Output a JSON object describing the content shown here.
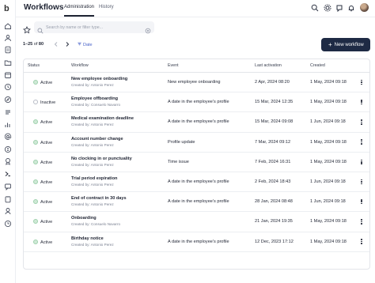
{
  "header": {
    "title": "Workflows",
    "tabs": [
      {
        "label": "Administration",
        "active": true
      },
      {
        "label": "History",
        "active": false
      }
    ],
    "icons": [
      "search-icon",
      "gear-icon",
      "help-icon",
      "bell-icon",
      "avatar"
    ]
  },
  "sidebar": {
    "logo": "b",
    "items": [
      "home-icon",
      "people-icon",
      "document-icon",
      "folder-icon",
      "calendar-icon",
      "clock-icon",
      "compass-icon",
      "checklist-icon",
      "chart-icon",
      "at-icon",
      "payroll-icon",
      "award-icon",
      "workflow-icon",
      "message-icon",
      "clipboard-icon",
      "user-icon",
      "history-icon"
    ]
  },
  "toolbar": {
    "search_placeholder": "Search by name or filter type...",
    "pager_range": "1–25",
    "pager_of": "of",
    "pager_total": "80",
    "sort_label": "Date",
    "new_button": "New workflow"
  },
  "table": {
    "columns": [
      "Status",
      "Workflow",
      "Event",
      "Last activation",
      "Created"
    ],
    "rows": [
      {
        "status": "Active",
        "name": "New employee onboarding",
        "by": "Created by: Antonio Perez",
        "event": "New employee onboarding",
        "last": "2 Apr, 2024 08:20",
        "created": "1 May, 2024 09:18"
      },
      {
        "status": "Inactive",
        "name": "Employee offboarding",
        "by": "Created by: Consuelo Navarro",
        "event": "A date in the employee's profile",
        "last": "15 Mar, 2024 12:35",
        "created": "1 May, 2024 09:18"
      },
      {
        "status": "Active",
        "name": "Medical examination deadline",
        "by": "Created by: Antonio Perez",
        "event": "A date in the employee's profile",
        "last": "15 Mar, 2024 09:08",
        "created": "1 Jun, 2024 09:18"
      },
      {
        "status": "Active",
        "name": "Account number change",
        "by": "Created by: Antonio Perez",
        "event": "Profile update",
        "last": "7 Mar, 2024 09:12",
        "created": "1 May, 2024 09:18"
      },
      {
        "status": "Active",
        "name": "No clocking in or punctuality",
        "by": "Created by: Antonio Perez",
        "event": "Time issue",
        "last": "7 Feb, 2024 16:31",
        "created": "1 May, 2024 09:18"
      },
      {
        "status": "Active",
        "name": "Trial period expiration",
        "by": "Created by: Antonio Perez",
        "event": "A date in the employee's profile",
        "last": "2 Feb, 2024 18:43",
        "created": "1 Jun, 2024 09:18"
      },
      {
        "status": "Active",
        "name": "End of contract in 30 days",
        "by": "Created by: Antonio Perez",
        "event": "A date in the employee's profile",
        "last": "28 Jan, 2024 08:48",
        "created": "1 Jun, 2024 09:18"
      },
      {
        "status": "Active",
        "name": "Onboarding",
        "by": "Created by: Consuelo Navarro",
        "event": "",
        "last": "21 Jan, 2024 19:35",
        "created": "1 May, 2024 09:18"
      },
      {
        "status": "Active",
        "name": "Birthday notice",
        "by": "Created by: Antonio Perez",
        "event": "A date in the employee's profile",
        "last": "12 Dec, 2023 17:12",
        "created": "1 May, 2024 09:18"
      }
    ]
  }
}
